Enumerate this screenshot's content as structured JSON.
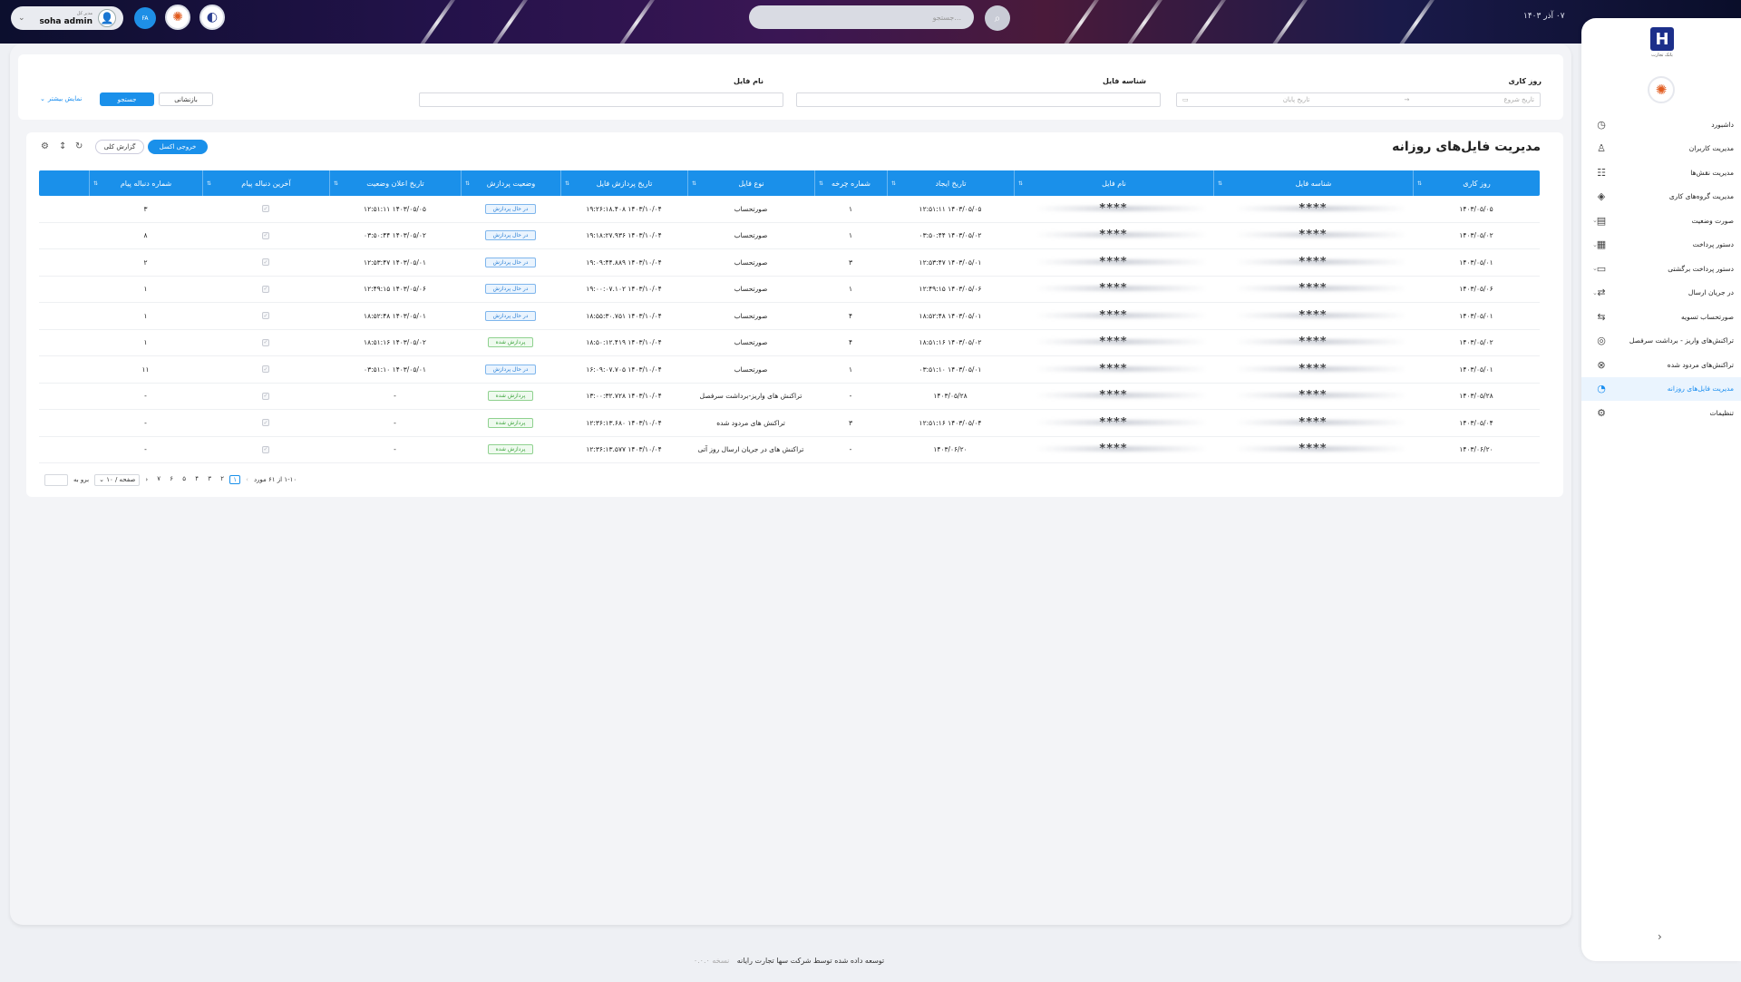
{
  "topbar": {
    "user_role": "مدیر کل",
    "user_name": "soha admin",
    "lang": "FA",
    "search_placeholder": "جستجو...",
    "date": "۰۷ آذر ۱۴۰۳"
  },
  "filters": {
    "workday_label": "روز کاری",
    "start_date_placeholder": "تاریخ شروع",
    "end_date_placeholder": "تاریخ پایان",
    "file_id_label": "شناسه فایل",
    "file_name_label": "نام فایل",
    "search_button": "جستجو",
    "reset_button": "بازنشانی",
    "more_link": "نمایش بیشتر"
  },
  "table": {
    "title": "مدیریت فایل‌های روزانه",
    "excel_button": "خروجی اکسل",
    "report_button": "گزارش کلی",
    "columns": [
      "روز کاری",
      "شناسه فایل",
      "نام فایل",
      "تاریخ ایجاد",
      "شماره چرخه",
      "نوع فایل",
      "تاریخ پردازش فایل",
      "وضعیت پردازش",
      "تاریخ اعلان وضعیت",
      "آخرین دنباله پیام",
      "شماره دنباله پیام"
    ],
    "rows": [
      {
        "day": "۱۴۰۳/۰۵/۰۵",
        "fid": "****",
        "fname": "****",
        "created": "۱۴۰۳/۰۵/۰۵ ۱۲:۵۱:۱۱",
        "cycle": "۱",
        "type": "صورتحساب",
        "processed": "۱۴۰۳/۱۰/۰۴ ۱۹:۲۶:۱۸.۴۰۸",
        "status": "در حال پردازش",
        "status_kind": "processing",
        "notified": "۱۴۰۳/۰۵/۰۵ ۱۲:۵۱:۱۱",
        "seq": "۳"
      },
      {
        "day": "۱۴۰۳/۰۵/۰۲",
        "fid": "****",
        "fname": "****",
        "created": "۱۴۰۳/۰۵/۰۲ ۰۳:۵۰:۴۴",
        "cycle": "۱",
        "type": "صورتحساب",
        "processed": "۱۴۰۳/۱۰/۰۴ ۱۹:۱۸:۲۷.۹۳۶",
        "status": "در حال پردازش",
        "status_kind": "processing",
        "notified": "۱۴۰۳/۰۵/۰۲ ۰۳:۵۰:۴۴",
        "seq": "۸"
      },
      {
        "day": "۱۴۰۳/۰۵/۰۱",
        "fid": "****",
        "fname": "****",
        "created": "۱۴۰۳/۰۵/۰۱ ۱۲:۵۳:۴۷",
        "cycle": "۳",
        "type": "صورتحساب",
        "processed": "۱۴۰۳/۱۰/۰۴ ۱۹:۰۹:۴۴.۸۸۹",
        "status": "در حال پردازش",
        "status_kind": "processing",
        "notified": "۱۴۰۳/۰۵/۰۱ ۱۲:۵۳:۴۷",
        "seq": "۲"
      },
      {
        "day": "۱۴۰۳/۰۵/۰۶",
        "fid": "****",
        "fname": "****",
        "created": "۱۴۰۳/۰۵/۰۶ ۱۲:۴۹:۱۵",
        "cycle": "۱",
        "type": "صورتحساب",
        "processed": "۱۴۰۳/۱۰/۰۴ ۱۹:۰۰:۰۷.۱۰۲",
        "status": "در حال پردازش",
        "status_kind": "processing",
        "notified": "۱۴۰۳/۰۵/۰۶ ۱۲:۴۹:۱۵",
        "seq": "۱"
      },
      {
        "day": "۱۴۰۳/۰۵/۰۱",
        "fid": "****",
        "fname": "****",
        "created": "۱۴۰۳/۰۵/۰۱ ۱۸:۵۲:۴۸",
        "cycle": "۴",
        "type": "صورتحساب",
        "processed": "۱۴۰۳/۱۰/۰۴ ۱۸:۵۵:۳۰.۷۵۱",
        "status": "در حال پردازش",
        "status_kind": "processing",
        "notified": "۱۴۰۳/۰۵/۰۱ ۱۸:۵۲:۴۸",
        "seq": "۱"
      },
      {
        "day": "۱۴۰۳/۰۵/۰۲",
        "fid": "****",
        "fname": "****",
        "created": "۱۴۰۳/۰۵/۰۲ ۱۸:۵۱:۱۶",
        "cycle": "۴",
        "type": "صورتحساب",
        "processed": "۱۴۰۳/۱۰/۰۴ ۱۸:۵۰:۱۲.۴۱۹",
        "status": "پردازش شده",
        "status_kind": "done",
        "notified": "۱۴۰۳/۰۵/۰۲ ۱۸:۵۱:۱۶",
        "seq": "۱"
      },
      {
        "day": "۱۴۰۳/۰۵/۰۱",
        "fid": "****",
        "fname": "****",
        "created": "۱۴۰۳/۰۵/۰۱ ۰۳:۵۱:۱۰",
        "cycle": "۱",
        "type": "صورتحساب",
        "processed": "۱۴۰۳/۱۰/۰۴ ۱۶:۰۹:۰۷.۷۰۵",
        "status": "در حال پردازش",
        "status_kind": "processing",
        "notified": "۱۴۰۳/۰۵/۰۱ ۰۳:۵۱:۱۰",
        "seq": "۱۱"
      },
      {
        "day": "۱۴۰۳/۰۵/۲۸",
        "fid": "****",
        "fname": "****",
        "created": "۱۴۰۳/۰۵/۲۸",
        "cycle": "-",
        "type": "تراکنش های واریز-برداشت سرفصل",
        "processed": "۱۴۰۳/۱۰/۰۴ ۱۳:۰۰:۳۲.۷۲۸",
        "status": "پردازش شده",
        "status_kind": "done",
        "notified": "-",
        "seq": "-"
      },
      {
        "day": "۱۴۰۳/۰۵/۰۴",
        "fid": "****",
        "fname": "****",
        "created": "۱۴۰۳/۰۵/۰۴ ۱۲:۵۱:۱۶",
        "cycle": "۳",
        "type": "تراکنش های مردود شده",
        "processed": "۱۴۰۳/۱۰/۰۴ ۱۲:۳۶:۱۳.۶۸۰",
        "status": "پردازش شده",
        "status_kind": "done",
        "notified": "-",
        "seq": "-"
      },
      {
        "day": "۱۴۰۳/۰۶/۲۰",
        "fid": "****",
        "fname": "****",
        "created": "۱۴۰۳/۰۶/۲۰",
        "cycle": "-",
        "type": "تراکنش های در جریان ارسال روز آتی",
        "processed": "۱۴۰۳/۱۰/۰۴ ۱۲:۳۶:۱۳.۵۷۷",
        "status": "پردازش شده",
        "status_kind": "done",
        "notified": "-",
        "seq": "-"
      }
    ]
  },
  "pager": {
    "summary": "۱-۱۰ از ۶۱ مورد",
    "pages": [
      "۱",
      "۲",
      "۳",
      "۴",
      "۵",
      "۶",
      "۷"
    ],
    "active_page": "۱",
    "page_size": "۱۰ / صفحه",
    "goto_label": "برو به"
  },
  "sidebar": {
    "brand_caption": "بانک تجارت",
    "items": [
      {
        "label": "داشبورد",
        "icon": "dashboard-icon",
        "glyph": "◷",
        "expandable": false
      },
      {
        "label": "مدیریت کاربران",
        "icon": "users-icon",
        "glyph": "♙",
        "expandable": false
      },
      {
        "label": "مدیریت نقش‌ها",
        "icon": "roles-icon",
        "glyph": "☷",
        "expandable": false
      },
      {
        "label": "مدیریت گروه‌های کاری",
        "icon": "layers-icon",
        "glyph": "◈",
        "expandable": false
      },
      {
        "label": "صورت وضعیت",
        "icon": "statement-icon",
        "glyph": "▤",
        "expandable": true
      },
      {
        "label": "دستور پرداخت",
        "icon": "payment-order-icon",
        "glyph": "▦",
        "expandable": true
      },
      {
        "label": "دستور پرداخت برگشتی",
        "icon": "returned-payment-icon",
        "glyph": "▭",
        "expandable": true
      },
      {
        "label": "در جریان ارسال",
        "icon": "sending-icon",
        "glyph": "⇄",
        "expandable": true
      },
      {
        "label": "صورتحساب تسویه",
        "icon": "settlement-icon",
        "glyph": "⇆",
        "expandable": false
      },
      {
        "label": "تراکنش‌های واریز - برداشت سرفصل",
        "icon": "transactions-icon",
        "glyph": "◎",
        "expandable": false
      },
      {
        "label": "تراکنش‌های مردود شده",
        "icon": "rejected-icon",
        "glyph": "⊗",
        "expandable": false
      },
      {
        "label": "مدیریت فایل‌های روزانه",
        "icon": "files-icon",
        "glyph": "◔",
        "expandable": false,
        "active": true
      },
      {
        "label": "تنظیمات",
        "icon": "settings-icon",
        "glyph": "⚙",
        "expandable": false
      }
    ]
  },
  "footer": {
    "text": "توسعه داده شده توسط شرکت سها تجارت رایانه",
    "version": "نسخه ۰.۰.۰"
  },
  "colors": {
    "accent": "#1a90ea",
    "processing": "#2a7fd4",
    "done": "#3aa33a"
  }
}
